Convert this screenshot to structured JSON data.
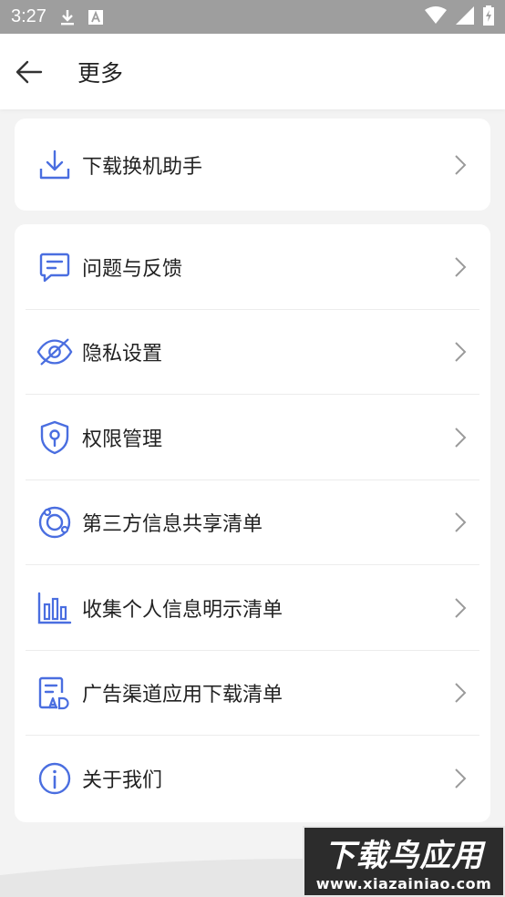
{
  "status_bar": {
    "time": "3:27"
  },
  "header": {
    "title": "更多"
  },
  "card1": {
    "items": [
      {
        "label": "下载换机助手",
        "icon": "download-icon"
      }
    ]
  },
  "card2": {
    "items": [
      {
        "label": "问题与反馈",
        "icon": "feedback-icon"
      },
      {
        "label": "隐私设置",
        "icon": "eye-off-icon"
      },
      {
        "label": "权限管理",
        "icon": "shield-icon"
      },
      {
        "label": "第三方信息共享清单",
        "icon": "orbit-icon"
      },
      {
        "label": "收集个人信息明示清单",
        "icon": "bar-chart-icon"
      },
      {
        "label": "广告渠道应用下载清单",
        "icon": "ad-document-icon"
      },
      {
        "label": "关于我们",
        "icon": "info-icon"
      }
    ]
  },
  "watermark": {
    "title": "下载鸟应用",
    "url": "www.xiazainiao.com"
  },
  "colors": {
    "accent": "#4a6ee0",
    "status_bar": "#9e9e9e",
    "background": "#f3f3f3"
  }
}
